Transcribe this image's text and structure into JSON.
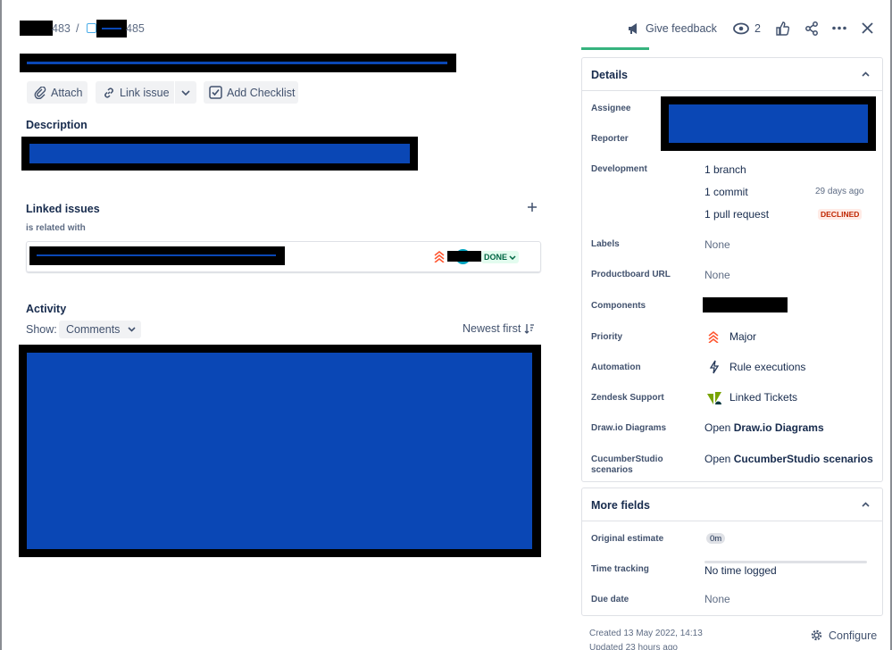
{
  "header": {
    "breadcrumb_parent_suffix": "483",
    "breadcrumb_separator": "/",
    "breadcrumb_issue_suffix": "485",
    "give_feedback": "Give feedback",
    "watchers_count": "2"
  },
  "toolbar": {
    "attach": "Attach",
    "link_issue": "Link issue",
    "add_checklist": "Add Checklist"
  },
  "description": {
    "title": "Description"
  },
  "linked_issues": {
    "title": "Linked issues",
    "relation": "is related with",
    "status": "DONE"
  },
  "activity": {
    "title": "Activity",
    "show_label": "Show:",
    "filter": "Comments",
    "sort": "Newest first"
  },
  "details": {
    "title": "Details",
    "assignee_label": "Assignee",
    "reporter_label": "Reporter",
    "development_label": "Development",
    "branch": "1 branch",
    "commit": "1 commit",
    "commit_time": "29 days ago",
    "pull_request": "1 pull request",
    "pr_status": "DECLINED",
    "labels_label": "Labels",
    "labels_value": "None",
    "productboard_label": "Productboard URL",
    "productboard_value": "None",
    "components_label": "Components",
    "priority_label": "Priority",
    "priority_value": "Major",
    "automation_label": "Automation",
    "automation_value": "Rule executions",
    "zendesk_label": "Zendesk Support",
    "zendesk_value": "Linked Tickets",
    "drawio_label": "Draw.io Diagrams",
    "drawio_prefix": "Open",
    "drawio_value": "Draw.io Diagrams",
    "cucumber_label_1": "CucumberStudio",
    "cucumber_label_2": "scenarios",
    "cucumber_prefix": "Open",
    "cucumber_value": "CucumberStudio scenarios"
  },
  "more_fields": {
    "title": "More fields",
    "original_estimate_label": "Original estimate",
    "original_estimate_value": "0m",
    "time_tracking_label": "Time tracking",
    "time_tracking_value": "No time logged",
    "due_date_label": "Due date",
    "due_date_value": "None"
  },
  "footer": {
    "created": "Created 13 May 2022, 14:13",
    "updated": "Updated 23 hours ago",
    "configure": "Configure"
  },
  "colors": {
    "redaction": "#000000",
    "redaction_fill": "#0a47b5",
    "done_green": "#006644",
    "declined_red": "#bf2600",
    "priority_orange": "#ff5630",
    "tab_green": "#36b37e"
  }
}
